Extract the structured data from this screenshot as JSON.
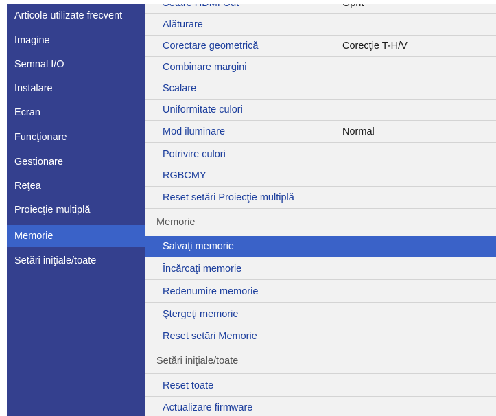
{
  "sidebar": {
    "items": [
      {
        "label": "Articole utilizate frecvent"
      },
      {
        "label": "Imagine"
      },
      {
        "label": "Semnal I/O"
      },
      {
        "label": "Instalare"
      },
      {
        "label": "Ecran"
      },
      {
        "label": "Funcţionare"
      },
      {
        "label": "Gestionare"
      },
      {
        "label": "Reţea"
      },
      {
        "label": "Proiecţie multiplă"
      },
      {
        "label": "Memorie"
      },
      {
        "label": "Setări iniţiale/toate"
      }
    ],
    "selected": "Memorie"
  },
  "content": {
    "partial_top": {
      "label": "Setare HDMI Out",
      "value": "Oprit"
    },
    "multi_projection_items": [
      {
        "label": "Alăturare",
        "value": ""
      },
      {
        "label": "Corectare geometrică",
        "value": "Corecţie T-H/V"
      },
      {
        "label": "Combinare margini",
        "value": ""
      },
      {
        "label": "Scalare",
        "value": ""
      },
      {
        "label": "Uniformitate culori",
        "value": ""
      },
      {
        "label": "Mod iluminare",
        "value": "Normal"
      },
      {
        "label": "Potrivire culori",
        "value": ""
      },
      {
        "label": "RGBCMY",
        "value": ""
      },
      {
        "label": "Reset setări Proiecţie multiplă",
        "value": ""
      }
    ],
    "memory_section": {
      "title": "Memorie",
      "items": [
        {
          "label": "Salvaţi memorie"
        },
        {
          "label": "Încărcaţi memorie"
        },
        {
          "label": "Redenumire memorie"
        },
        {
          "label": "Ştergeţi memorie"
        },
        {
          "label": "Reset setări Memorie"
        }
      ],
      "selected": "Salvaţi memorie"
    },
    "initial_section": {
      "title": "Setări iniţiale/toate",
      "items": [
        {
          "label": "Reset toate"
        },
        {
          "label": "Actualizare firmware"
        }
      ]
    }
  },
  "colors": {
    "sidebar_bg": "#34408e",
    "selection": "#3a62c8",
    "content_bg": "#f2f2f2",
    "item_text": "#1d3f9d"
  }
}
